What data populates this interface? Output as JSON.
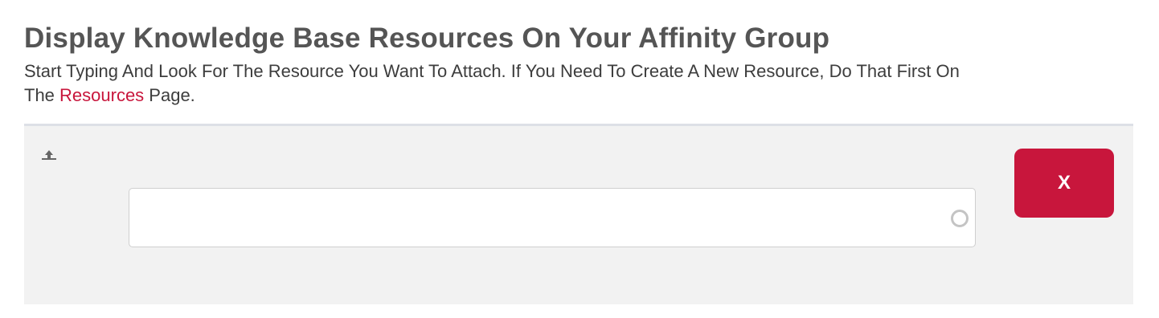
{
  "header": {
    "title": "Display Knowledge Base Resources On Your Affinity Group",
    "description_before_link": "Start Typing And Look For The Resource You Want To Attach. If You Need To Create A New Resource, Do That First On The ",
    "link_text": "Resources",
    "description_after_link": " Page."
  },
  "resource_row": {
    "drag_icon": "move-up-icon",
    "search_value": "",
    "search_placeholder": "",
    "loading_icon": "spinner-icon",
    "remove_label": "X"
  },
  "colors": {
    "accent": "#c8163c",
    "panel_background": "#f2f2f2",
    "title_text": "#555555"
  }
}
